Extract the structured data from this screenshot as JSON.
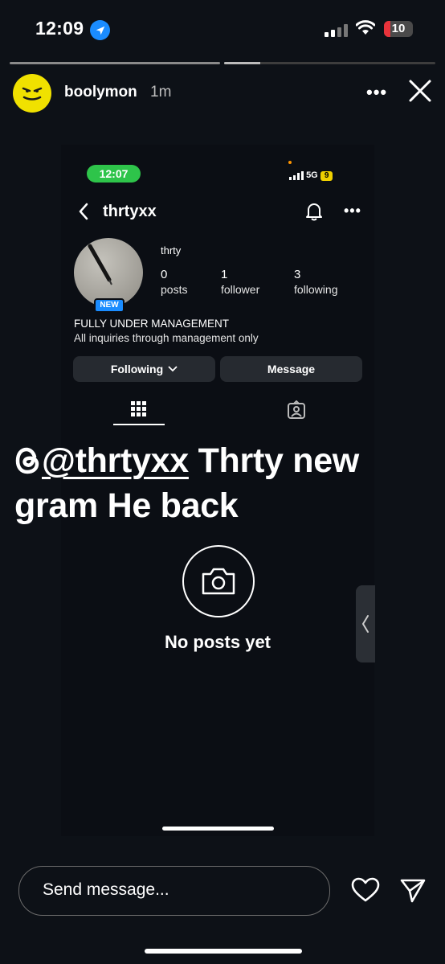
{
  "status_bar": {
    "time": "12:09",
    "battery": "10",
    "battery_color": "#e8333b"
  },
  "story": {
    "username": "boolymon",
    "age": "1m",
    "more": "•••",
    "progress_active_fraction": 0.17
  },
  "screenshot": {
    "status_time": "12:07",
    "status_net": "5G",
    "status_battery": "9",
    "handle": "thrtyxx",
    "more": "•••",
    "badge": "NEW",
    "display_name": "thrty",
    "stats": [
      {
        "value": "0",
        "label": "posts"
      },
      {
        "value": "1",
        "label": "follower"
      },
      {
        "value": "3",
        "label": "following"
      }
    ],
    "bio_line1": "FULLY UNDER MANAGEMENT",
    "bio_line2": "All inquiries through management only",
    "buttons": {
      "following": "Following",
      "message": "Message"
    },
    "empty_state": "No posts yet"
  },
  "caption": {
    "mention": "@thrtyxx",
    "text": "Thrty new gram He back"
  },
  "bottom": {
    "placeholder": "Send message..."
  },
  "icons": [
    "location-icon",
    "signal-icon",
    "wifi-icon",
    "battery-icon",
    "more-icon",
    "close-icon",
    "back-icon",
    "bell-icon",
    "grid-icon",
    "tagged-icon",
    "camera-icon",
    "threads-icon",
    "heart-icon",
    "send-icon",
    "chevron-left-icon"
  ]
}
